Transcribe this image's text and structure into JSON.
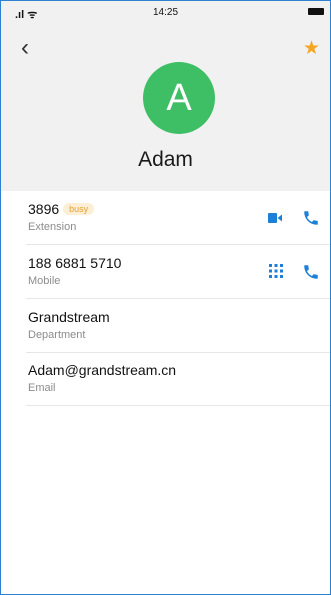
{
  "status_bar": {
    "signal": ".ıl ᯤ",
    "time": "14:25"
  },
  "header": {
    "back_glyph": "‹",
    "star_glyph": "★",
    "avatar_letter": "A",
    "name": "Adam"
  },
  "fields": {
    "extension": {
      "value": "3896",
      "badge": "busy",
      "label": "Extension"
    },
    "mobile": {
      "value": "188 6881 5710",
      "label": "Mobile"
    },
    "department": {
      "value": "Grandstream",
      "label": "Department"
    },
    "email": {
      "value": "Adam@grandstream.cn",
      "label": "Email"
    }
  },
  "colors": {
    "accent": "#1e7fd8",
    "avatar": "#3fbf65",
    "star": "#f5a623",
    "badge_text": "#e5a135",
    "badge_bg": "#fcefd6"
  },
  "icons": [
    "back-icon",
    "star-icon",
    "video-call-icon",
    "phone-icon",
    "dialpad-icon"
  ]
}
